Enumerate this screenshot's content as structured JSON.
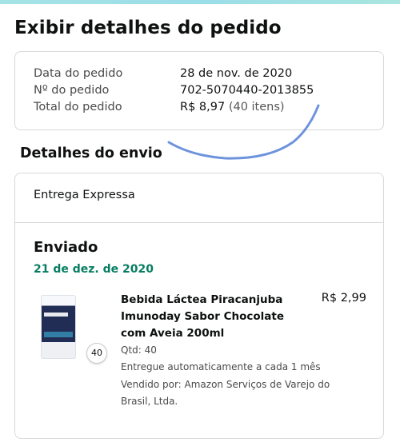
{
  "page_title": "Exibir detalhes do pedido",
  "order_summary": {
    "date_label": "Data do pedido",
    "date_value": "28 de nov. de 2020",
    "number_label": "Nº do pedido",
    "number_value": "702-5070440-2013855",
    "total_label": "Total do pedido",
    "total_value": "R$ 8,97",
    "total_items": "(40 itens)"
  },
  "shipping": {
    "heading": "Detalhes do envio",
    "delivery_type": "Entrega Expressa",
    "status": "Enviado",
    "date": "21 de dez. de 2020",
    "status_color": "#067d62",
    "item": {
      "title": "Bebida Láctea Piracanjuba Imunoday Sabor Chocolate com Aveia 200ml",
      "price": "R$ 2,99",
      "quantity_badge": "40",
      "qty": "Qtd: 40",
      "subscription": "Entregue automaticamente a cada 1 mês",
      "seller": "Vendido por: Amazon Serviços de Varejo do Brasil, Ltda.",
      "image_icon": "product-carton-icon"
    }
  }
}
